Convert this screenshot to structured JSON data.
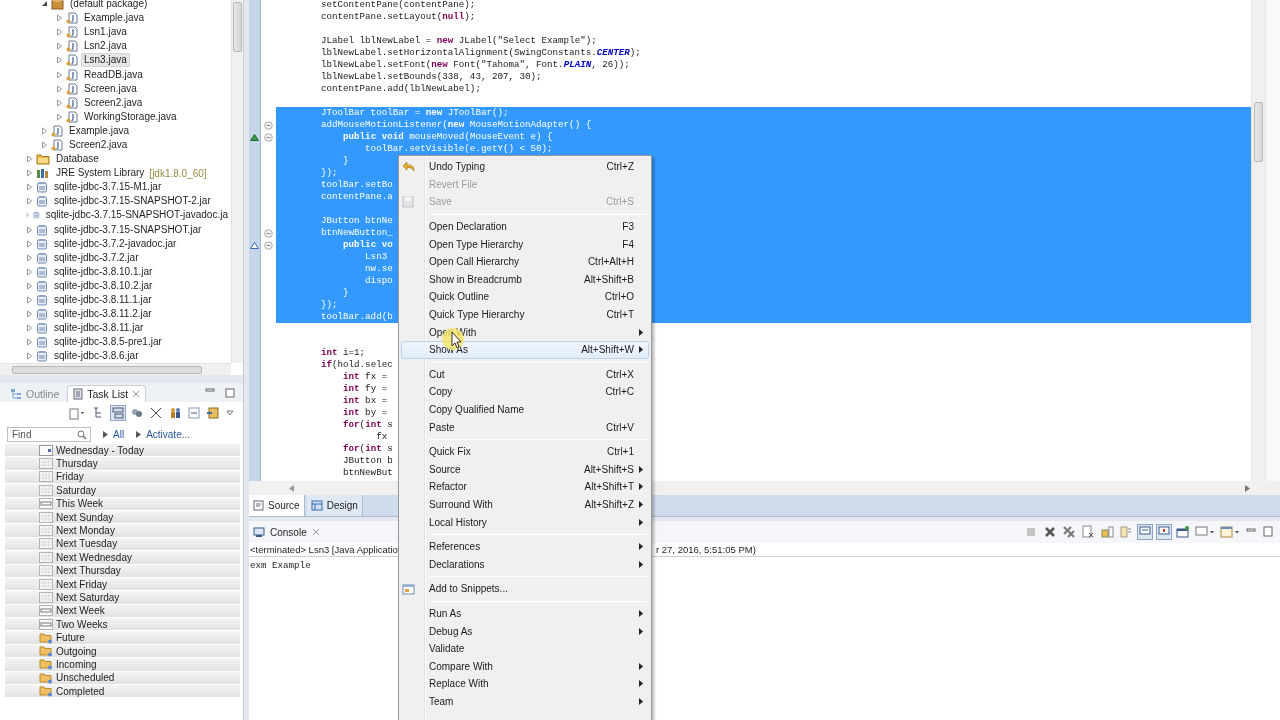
{
  "package_explorer": {
    "upper_items": [
      {
        "label": "(default package)",
        "kind": "package",
        "expanded": true,
        "selected": false,
        "children": [
          {
            "label": "Example.java",
            "kind": "java",
            "expanded": false,
            "selected": false
          },
          {
            "label": "Lsn1.java",
            "kind": "java",
            "expanded": false,
            "selected": false
          },
          {
            "label": "Lsn2.java",
            "kind": "java",
            "expanded": false,
            "selected": false
          },
          {
            "label": "Lsn3.java",
            "kind": "java",
            "expanded": false,
            "selected": true
          },
          {
            "label": "ReadDB.java",
            "kind": "java",
            "expanded": false,
            "selected": false
          },
          {
            "label": "Screen.java",
            "kind": "java",
            "expanded": false,
            "selected": false
          },
          {
            "label": "Screen2.java",
            "kind": "java",
            "expanded": false,
            "selected": false
          },
          {
            "label": "WorkingStorage.java",
            "kind": "java",
            "expanded": false,
            "selected": false
          }
        ]
      },
      {
        "label": "Example.java",
        "kind": "java",
        "expanded": false,
        "selected": false
      },
      {
        "label": "Screen2.java",
        "kind": "java",
        "expanded": false,
        "selected": false
      }
    ],
    "items": [
      {
        "label": "Database",
        "kind": "folder",
        "expanded": false,
        "selected": false
      },
      {
        "label": "JRE System Library",
        "decoration": "[jdk1.8.0_60]",
        "kind": "library",
        "expanded": false,
        "selected": false
      },
      {
        "label": "sqlite-jdbc-3.7.15-M1.jar",
        "kind": "jar",
        "expanded": false,
        "selected": false
      },
      {
        "label": "sqlite-jdbc-3.7.15-SNAPSHOT-2.jar",
        "kind": "jar",
        "expanded": false,
        "selected": false
      },
      {
        "label": "sqlite-jdbc-3.7.15-SNAPSHOT-javadoc.ja",
        "kind": "jar",
        "expanded": false,
        "selected": false
      },
      {
        "label": "sqlite-jdbc-3.7.15-SNAPSHOT.jar",
        "kind": "jar",
        "expanded": false,
        "selected": false
      },
      {
        "label": "sqlite-jdbc-3.7.2-javadoc.jar",
        "kind": "jar",
        "expanded": false,
        "selected": false
      },
      {
        "label": "sqlite-jdbc-3.7.2.jar",
        "kind": "jar",
        "expanded": false,
        "selected": false
      },
      {
        "label": "sqlite-jdbc-3.8.10.1.jar",
        "kind": "jar",
        "expanded": false,
        "selected": false
      },
      {
        "label": "sqlite-jdbc-3.8.10.2.jar",
        "kind": "jar",
        "expanded": false,
        "selected": false
      },
      {
        "label": "sqlite-jdbc-3.8.11.1.jar",
        "kind": "jar",
        "expanded": false,
        "selected": false
      },
      {
        "label": "sqlite-jdbc-3.8.11.2.jar",
        "kind": "jar",
        "expanded": false,
        "selected": false
      },
      {
        "label": "sqlite-jdbc-3.8.11.jar",
        "kind": "jar",
        "expanded": false,
        "selected": false
      },
      {
        "label": "sqlite-jdbc-3.8.5-pre1.jar",
        "kind": "jar",
        "expanded": false,
        "selected": false
      },
      {
        "label": "sqlite-jdbc-3.8.6.jar",
        "kind": "jar",
        "expanded": false,
        "selected": false
      }
    ]
  },
  "task_list": {
    "tabs": [
      {
        "label": "Outline",
        "selected": false
      },
      {
        "label": "Task List",
        "selected": true
      }
    ],
    "find": {
      "placeholder": "Find"
    },
    "filters": [
      "All",
      "Activate..."
    ],
    "groups": [
      {
        "label": "Wednesday - Today",
        "kind": "today"
      },
      {
        "label": "Thursday",
        "kind": "day"
      },
      {
        "label": "Friday",
        "kind": "day"
      },
      {
        "label": "Saturday",
        "kind": "day"
      },
      {
        "label": "This Week",
        "kind": "week"
      },
      {
        "label": "Next Sunday",
        "kind": "day"
      },
      {
        "label": "Next Monday",
        "kind": "day"
      },
      {
        "label": "Next Tuesday",
        "kind": "day"
      },
      {
        "label": "Next Wednesday",
        "kind": "day"
      },
      {
        "label": "Next Thursday",
        "kind": "day"
      },
      {
        "label": "Next Friday",
        "kind": "day"
      },
      {
        "label": "Next Saturday",
        "kind": "day"
      },
      {
        "label": "Next Week",
        "kind": "week"
      },
      {
        "label": "Two Weeks",
        "kind": "week"
      },
      {
        "label": "Future",
        "kind": "folder"
      },
      {
        "label": "Outgoing",
        "kind": "folder"
      },
      {
        "label": "Incoming",
        "kind": "folder"
      },
      {
        "label": "Unscheduled",
        "kind": "folder"
      },
      {
        "label": "Completed",
        "kind": "folder"
      }
    ]
  },
  "editor": {
    "lines": [
      {
        "kind": "code",
        "text": "setContentPane(contentPane);",
        "selected": false
      },
      {
        "kind": "code",
        "text": "contentPane.setLayout(**null**);",
        "selected": false
      },
      {
        "kind": "blank",
        "selected": false
      },
      {
        "kind": "code",
        "text": "JLabel lblNewLabel = **new** JLabel(\"Select Example\");",
        "selected": false
      },
      {
        "kind": "code",
        "text": "lblNewLabel.setHorizontalAlignment(SwingConstants.*CENTER*);",
        "selected": false
      },
      {
        "kind": "code",
        "text": "lblNewLabel.setFont(**new** Font(\"Tahoma\", Font.*PLAIN*, 26));",
        "selected": false
      },
      {
        "kind": "code",
        "text": "lblNewLabel.setBounds(338, 43, 207, 30);",
        "selected": false
      },
      {
        "kind": "code",
        "text": "contentPane.add(lblNewLabel);",
        "selected": false
      },
      {
        "kind": "blank",
        "selected": false
      },
      {
        "kind": "code",
        "text": "JToolBar toolBar = **new** JToolBar();",
        "selected": true
      },
      {
        "kind": "code",
        "text": "addMouseMotionListener(**new** MouseMotionAdapter() {",
        "selected": true,
        "fold": true
      },
      {
        "kind": "code",
        "text": "    **public** **void** mouseMoved(MouseEvent e) {",
        "selected": true,
        "fold": true,
        "override": true
      },
      {
        "kind": "code",
        "text": "        toolBar.setVisible(e.getY() < 50);",
        "selected": true
      },
      {
        "kind": "code",
        "text": "    }",
        "selected": true
      },
      {
        "kind": "code",
        "text": "});",
        "selected": true
      },
      {
        "kind": "code",
        "text": "toolBar.setBo",
        "selected": true
      },
      {
        "kind": "code",
        "text": "contentPane.a",
        "selected": true
      },
      {
        "kind": "blank",
        "selected": true
      },
      {
        "kind": "code",
        "text": "JButton btnNe",
        "selected": true
      },
      {
        "kind": "code",
        "text": "btnNewButton_",
        "selected": true,
        "fold": true
      },
      {
        "kind": "code",
        "text": "    **public** **vo**",
        "selected": true,
        "fold": true,
        "implements": true
      },
      {
        "kind": "code",
        "text": "        Lsn3",
        "selected": true
      },
      {
        "kind": "code",
        "text": "        nw.se",
        "selected": true
      },
      {
        "kind": "code",
        "text": "        dispo",
        "selected": true
      },
      {
        "kind": "code",
        "text": "    }",
        "selected": true
      },
      {
        "kind": "code",
        "text": "});",
        "selected": true
      },
      {
        "kind": "code",
        "text": "toolBar.add(b",
        "selected": true
      },
      {
        "kind": "blank",
        "selected": false
      },
      {
        "kind": "blank",
        "selected": false
      },
      {
        "kind": "code",
        "text": "**int** i=1;",
        "selected": false
      },
      {
        "kind": "code",
        "text": "**if**(hold.selec",
        "selected": false
      },
      {
        "kind": "code",
        "text": "    **int** fx =",
        "selected": false
      },
      {
        "kind": "code",
        "text": "    **int** fy =",
        "selected": false
      },
      {
        "kind": "code",
        "text": "    **int** bx =",
        "selected": false
      },
      {
        "kind": "code",
        "text": "    **int** by =",
        "selected": false
      },
      {
        "kind": "code",
        "text": "    **for**(**int** s",
        "selected": false
      },
      {
        "kind": "code",
        "text": "          fx",
        "selected": false
      },
      {
        "kind": "code",
        "text": "    **for**(**int** s",
        "selected": false
      },
      {
        "kind": "code",
        "text": "    JButton b",
        "selected": false
      },
      {
        "kind": "code",
        "text": "    btnNewBut",
        "selected": false
      }
    ],
    "tabs": [
      {
        "label": "Source",
        "selected": true
      },
      {
        "label": "Design",
        "selected": false
      }
    ]
  },
  "console": {
    "title": "Console",
    "status_start": "<terminated> Lsn3 [Java Applicatio",
    "status_end": "r 27, 2016, 5:51:05 PM)",
    "output": "exm Example"
  },
  "context_menu": {
    "items": [
      {
        "kind": "undo",
        "label": "Undo Typing",
        "shortcut": "Ctrl+Z",
        "disabled": false,
        "submenu": false,
        "hovered": false
      },
      {
        "kind": "plain",
        "label": "Revert File",
        "disabled": true,
        "submenu": false,
        "hovered": false
      },
      {
        "kind": "save",
        "label": "Save",
        "shortcut": "Ctrl+S",
        "disabled": true,
        "submenu": false,
        "hovered": false
      },
      {
        "kind": "separator"
      },
      {
        "kind": "plain",
        "label": "Open Declaration",
        "shortcut": "F3",
        "disabled": false,
        "submenu": false,
        "hovered": false
      },
      {
        "kind": "plain",
        "label": "Open Type Hierarchy",
        "shortcut": "F4",
        "disabled": false,
        "submenu": false,
        "hovered": false
      },
      {
        "kind": "plain",
        "label": "Open Call Hierarchy",
        "shortcut": "Ctrl+Alt+H",
        "disabled": false,
        "submenu": false,
        "hovered": false
      },
      {
        "kind": "plain",
        "label": "Show in Breadcrumb",
        "shortcut": "Alt+Shift+B",
        "disabled": false,
        "submenu": false,
        "hovered": false
      },
      {
        "kind": "plain",
        "label": "Quick Outline",
        "shortcut": "Ctrl+O",
        "disabled": false,
        "submenu": false,
        "hovered": false
      },
      {
        "kind": "plain",
        "label": "Quick Type Hierarchy",
        "shortcut": "Ctrl+T",
        "disabled": false,
        "submenu": false,
        "hovered": false
      },
      {
        "kind": "plain",
        "label": "Open With",
        "disabled": false,
        "submenu": true,
        "hovered": false
      },
      {
        "kind": "plain",
        "label": "Show As",
        "shortcut": "Alt+Shift+W",
        "disabled": false,
        "submenu": true,
        "hovered": true
      },
      {
        "kind": "separator"
      },
      {
        "kind": "plain",
        "label": "Cut",
        "shortcut": "Ctrl+X",
        "disabled": false,
        "submenu": false,
        "hovered": false
      },
      {
        "kind": "plain",
        "label": "Copy",
        "shortcut": "Ctrl+C",
        "disabled": false,
        "submenu": false,
        "hovered": false
      },
      {
        "kind": "plain",
        "label": "Copy Qualified Name",
        "disabled": false,
        "submenu": false,
        "hovered": false
      },
      {
        "kind": "plain",
        "label": "Paste",
        "shortcut": "Ctrl+V",
        "disabled": false,
        "submenu": false,
        "hovered": false
      },
      {
        "kind": "separator"
      },
      {
        "kind": "plain",
        "label": "Quick Fix",
        "shortcut": "Ctrl+1",
        "disabled": false,
        "submenu": false,
        "hovered": false
      },
      {
        "kind": "plain",
        "label": "Source",
        "shortcut": "Alt+Shift+S",
        "disabled": false,
        "submenu": true,
        "hovered": false
      },
      {
        "kind": "plain",
        "label": "Refactor",
        "shortcut": "Alt+Shift+T",
        "disabled": false,
        "submenu": true,
        "hovered": false
      },
      {
        "kind": "plain",
        "label": "Surround With",
        "shortcut": "Alt+Shift+Z",
        "disabled": false,
        "submenu": true,
        "hovered": false
      },
      {
        "kind": "plain",
        "label": "Local History",
        "disabled": false,
        "submenu": true,
        "hovered": false
      },
      {
        "kind": "separator"
      },
      {
        "kind": "plain",
        "label": "References",
        "disabled": false,
        "submenu": true,
        "hovered": false
      },
      {
        "kind": "plain",
        "label": "Declarations",
        "disabled": false,
        "submenu": true,
        "hovered": false
      },
      {
        "kind": "separator"
      },
      {
        "kind": "snippets",
        "label": "Add to Snippets...",
        "disabled": false,
        "submenu": false,
        "hovered": false
      },
      {
        "kind": "separator"
      },
      {
        "kind": "plain",
        "label": "Run As",
        "disabled": false,
        "submenu": true,
        "hovered": false
      },
      {
        "kind": "plain",
        "label": "Debug As",
        "disabled": false,
        "submenu": true,
        "hovered": false
      },
      {
        "kind": "plain",
        "label": "Validate",
        "disabled": false,
        "submenu": false,
        "hovered": false
      },
      {
        "kind": "plain",
        "label": "Compare With",
        "disabled": false,
        "submenu": true,
        "hovered": false
      },
      {
        "kind": "plain",
        "label": "Replace With",
        "disabled": false,
        "submenu": true,
        "hovered": false
      },
      {
        "kind": "plain",
        "label": "Team",
        "disabled": false,
        "submenu": true,
        "hovered": false
      }
    ]
  }
}
